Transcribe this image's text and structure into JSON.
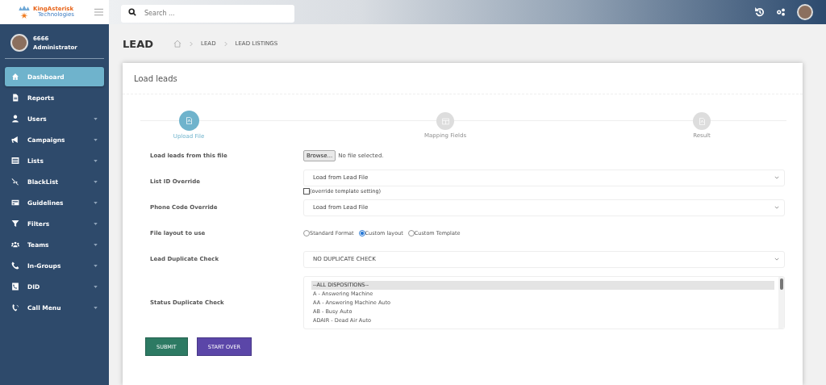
{
  "brand": {
    "name": "KingAsterisk",
    "tagline": "Technologies"
  },
  "search": {
    "placeholder": "Search ..."
  },
  "user": {
    "name": "6666",
    "role": "Administrator"
  },
  "sidebar": {
    "items": [
      {
        "label": "Dashboard",
        "selected": true,
        "has_submenu": false
      },
      {
        "label": "Reports",
        "selected": false,
        "has_submenu": false
      },
      {
        "label": "Users",
        "selected": false,
        "has_submenu": true
      },
      {
        "label": "Campaigns",
        "selected": false,
        "has_submenu": true
      },
      {
        "label": "Lists",
        "selected": false,
        "has_submenu": true
      },
      {
        "label": "BlackList",
        "selected": false,
        "has_submenu": true
      },
      {
        "label": "Guidelines",
        "selected": false,
        "has_submenu": true
      },
      {
        "label": "Filters",
        "selected": false,
        "has_submenu": true
      },
      {
        "label": "Teams",
        "selected": false,
        "has_submenu": true
      },
      {
        "label": "In-Groups",
        "selected": false,
        "has_submenu": true
      },
      {
        "label": "DID",
        "selected": false,
        "has_submenu": true
      },
      {
        "label": "Call Menu",
        "selected": false,
        "has_submenu": true
      }
    ]
  },
  "page": {
    "title": "LEAD",
    "breadcrumb": [
      "LEAD",
      "LEAD LISTINGS"
    ]
  },
  "card": {
    "title": "Load leads",
    "steps": [
      {
        "label": "Upload File",
        "selected": true
      },
      {
        "label": "Mapping Fields",
        "selected": false
      },
      {
        "label": "Result",
        "selected": false
      }
    ],
    "fields": [
      {
        "kind": "file",
        "label": "Load leads from this file",
        "button": "Browse...",
        "status": "No file selected."
      },
      {
        "kind": "select",
        "label": "List ID Override",
        "value": "Load from Lead File",
        "checkbox": {
          "label": "(override template setting)",
          "checked": false
        }
      },
      {
        "kind": "select",
        "label": "Phone Code Override",
        "value": "Load from Lead File"
      },
      {
        "kind": "radio",
        "label": "File layout to use",
        "options": [
          {
            "label": "Standard Format",
            "selected": false
          },
          {
            "label": "Custom layout",
            "selected": true
          },
          {
            "label": "Custom Template",
            "selected": false
          }
        ]
      },
      {
        "kind": "select",
        "label": "Lead Duplicate Check",
        "value": "NO DUPLICATE CHECK"
      },
      {
        "kind": "listbox",
        "label": "Status Duplicate Check",
        "options": [
          {
            "label": "--ALL DISPOSITIONS--",
            "selected": true
          },
          {
            "label": "A - Answering Machine",
            "selected": false
          },
          {
            "label": "AA - Answering Machine Auto",
            "selected": false
          },
          {
            "label": "AB - Busy Auto",
            "selected": false
          },
          {
            "label": "ADAIR - Dead Air Auto",
            "selected": false
          }
        ]
      }
    ],
    "buttons": [
      {
        "label": "SUBMIT",
        "kind": "primary"
      },
      {
        "label": "START OVER",
        "kind": "secondary"
      }
    ]
  }
}
